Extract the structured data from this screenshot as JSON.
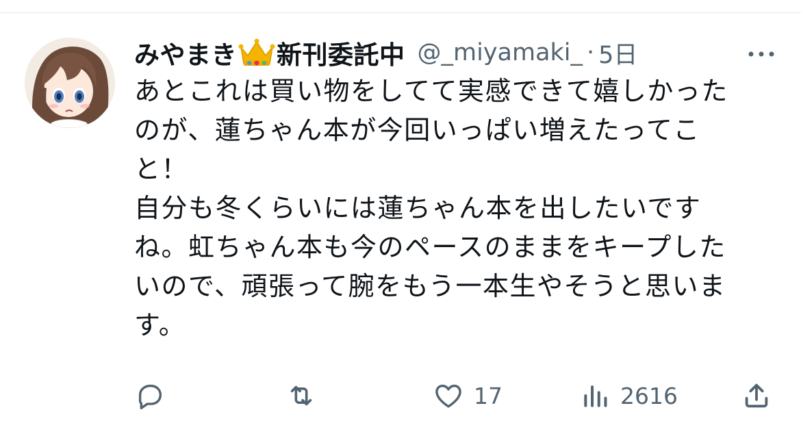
{
  "tweet": {
    "display_name": "みやまき",
    "display_name_suffix": "新刊委託中",
    "crown_emoji": "crown-icon",
    "handle": "@_miyamaki_",
    "separator": "·",
    "timestamp": "5日",
    "text": "あとこれは買い物をしてて実感できて嬉しかった\nのが、蓮ちゃん本が今回いっぱい増えたってこ\nと！\n自分も冬くらいには蓮ちゃん本を出したいです\nね。虹ちゃん本も今のペースのままをキープした\nいので、頑張って腕をもう一本生やそうと思いま\nす。"
  },
  "actions": {
    "reply": {
      "icon": "reply-icon",
      "count": ""
    },
    "retweet": {
      "icon": "retweet-icon",
      "count": ""
    },
    "like": {
      "icon": "heart-icon",
      "count": "17"
    },
    "views": {
      "icon": "views-icon",
      "count": "2616"
    },
    "share": {
      "icon": "share-icon"
    }
  },
  "colors": {
    "text": "#0f1419",
    "secondary": "#536471",
    "divider": "#e6e9ec"
  }
}
